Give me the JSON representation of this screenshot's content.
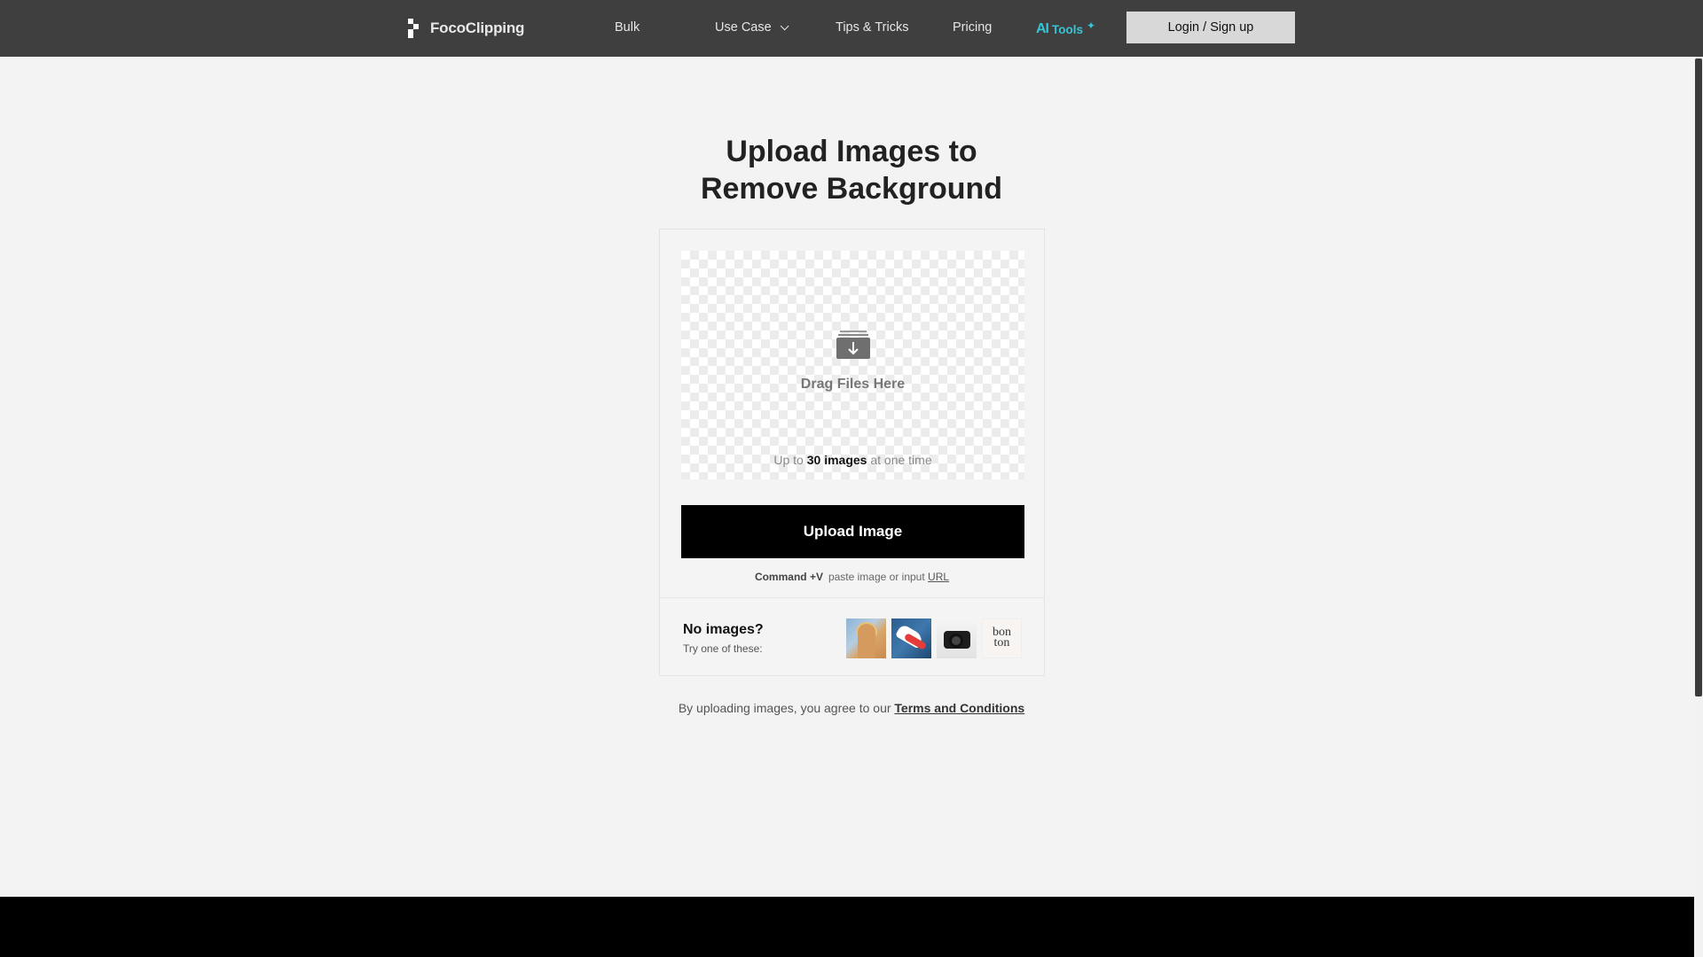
{
  "header": {
    "brand": "FocoClipping",
    "nav": {
      "bulk": "Bulk",
      "use_case": "Use Case",
      "tips": "Tips & Tricks",
      "pricing": "Pricing"
    },
    "ai_tools": {
      "mark": "AI",
      "label": "Tools"
    },
    "login_label": "Login / Sign up"
  },
  "main": {
    "title_line1": "Upload Images to",
    "title_line2": "Remove Background",
    "dropzone": {
      "drag_label": "Drag Files Here",
      "limit_prefix": "Up to ",
      "limit_count": "30 images",
      "limit_suffix": " at one time"
    },
    "upload_label": "Upload Image",
    "paste": {
      "shortcut": "Command +V",
      "text": "paste image or input ",
      "url_link": "URL"
    },
    "samples": {
      "heading": "No images?",
      "subheading": "Try one of these:",
      "bonton_line1": "bon",
      "bonton_line2": "ton"
    },
    "terms": {
      "prefix": "By uploading images, you agree to our ",
      "link": "Terms and Conditions"
    }
  },
  "colors": {
    "header_bg": "#3f3f3f",
    "accent_ai": "#35c5d6",
    "page_bg": "#f2f3f2",
    "primary_button": "#000000"
  }
}
